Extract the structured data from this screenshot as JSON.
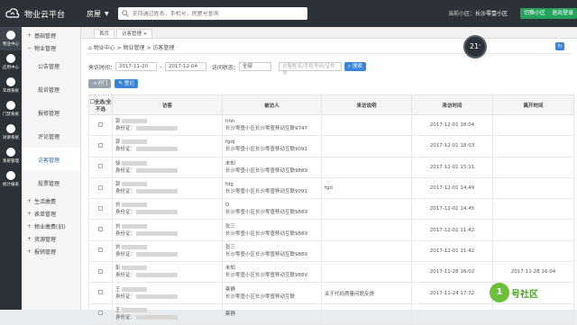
{
  "app": {
    "title": "物业云平台",
    "category": "房屋"
  },
  "search": {
    "placeholder": "支持通过姓名，手机号，房屋号查询"
  },
  "header": {
    "community_label": "当前小区：",
    "community_name": "长沙零壹小区",
    "switch_button": "切换小区",
    "logout_button": "退出登录"
  },
  "weather": {
    "temp": "21",
    "unit": "°"
  },
  "sidebar": {
    "items": [
      "物业中心",
      "应用中心",
      "车场系统",
      "门禁系统",
      "对讲系统",
      "系统管理",
      "统计报表"
    ]
  },
  "menu": {
    "top": [
      {
        "label": "基础管理",
        "sign": "+"
      },
      {
        "label": "物业管理",
        "sign": "−"
      }
    ],
    "sub": [
      "公告管理",
      "投诉管理",
      "报修管理",
      "评论管理",
      "访客管理",
      "投票管理"
    ],
    "bottom": [
      {
        "label": "生活缴费",
        "sign": "+"
      },
      {
        "label": "表单管理",
        "sign": "+"
      },
      {
        "label": "物业缴费(旧)",
        "sign": "+"
      },
      {
        "label": "资源管理",
        "sign": "+"
      },
      {
        "label": "报销管理",
        "sign": "+"
      }
    ]
  },
  "tabs": [
    "首页",
    "访客管理 ×"
  ],
  "breadcrumb": "物业中心 > 物业管理 > 访客管理",
  "filters": {
    "time_label": "来访时间：",
    "date_from": "2017-11-20",
    "date_to": "2017-12-04",
    "status_label": "访问状态：",
    "status_value": "全部",
    "keyword_placeholder": "访客姓名/手机号码/证件号",
    "search_button": "搜索"
  },
  "actions": {
    "open_button": "开门",
    "register_button": "登记"
  },
  "table": {
    "headers": [
      "全选/全不选",
      "访客",
      "被访人",
      "来访说明",
      "来访时间",
      "离开时间"
    ],
    "rows": [
      {
        "name": "郭",
        "id": "身份证：",
        "host": "hhh",
        "addr": "长沙零壹小区长沙零壹移动互联9747",
        "note": "",
        "time": "2017-12-01 18:04",
        "leave": ""
      },
      {
        "name": "郭",
        "id": "身份证：",
        "host": "fgdj",
        "addr": "长沙零壹小区长沙零壹移动互联9091",
        "note": "",
        "time": "2017-12-01 18:03",
        "leave": ""
      },
      {
        "name": "徐",
        "id": "身份证：",
        "host": "未知",
        "addr": "长沙零壹小区长沙零壹移动互联9889",
        "note": "",
        "time": "2017-12-01 15:11",
        "leave": ""
      },
      {
        "name": "郭",
        "id": "身份证：",
        "host": "fdg",
        "addr": "长沙零壹小区长沙零壹移动互联9091",
        "note": "fgd",
        "time": "2017-12-01 14:49",
        "leave": ""
      },
      {
        "name": "刘",
        "id": "身份证：",
        "host": "Q",
        "addr": "长沙零壹小区长沙零壹移动互联9889",
        "note": "",
        "time": "2017-12-01 14:45",
        "leave": ""
      },
      {
        "name": "刘",
        "id": "身份证：",
        "host": "张三",
        "addr": "长沙零壹小区长沙零壹移动互联9889",
        "note": "",
        "time": "2017-12-01 11:42",
        "leave": ""
      },
      {
        "name": "刘",
        "id": "身份证：",
        "host": "张三",
        "addr": "长沙零壹小区长沙零壹移动互联9889",
        "note": "",
        "time": "2017-12-01 11:42",
        "leave": ""
      },
      {
        "name": "彭",
        "id": "身份证：",
        "host": "未知",
        "addr": "长沙零壹小区长沙零壹移动互联988V",
        "note": "",
        "time": "2017-11-28 16:02",
        "leave": "2017-11-28 16:04"
      },
      {
        "name": "王",
        "id": "身份证：",
        "host": "蔡静",
        "addr": "长沙零壹小区长沙零壹移动互联",
        "note": "关于代码质量问题反馈",
        "time": "2017-11-24 17:32",
        "leave": ""
      },
      {
        "name": "王",
        "id": "身份证：",
        "host": "蔡静",
        "addr": "",
        "note": "",
        "time": "",
        "leave": ""
      }
    ]
  },
  "watermark": {
    "icon": "1",
    "text": "号社区"
  }
}
